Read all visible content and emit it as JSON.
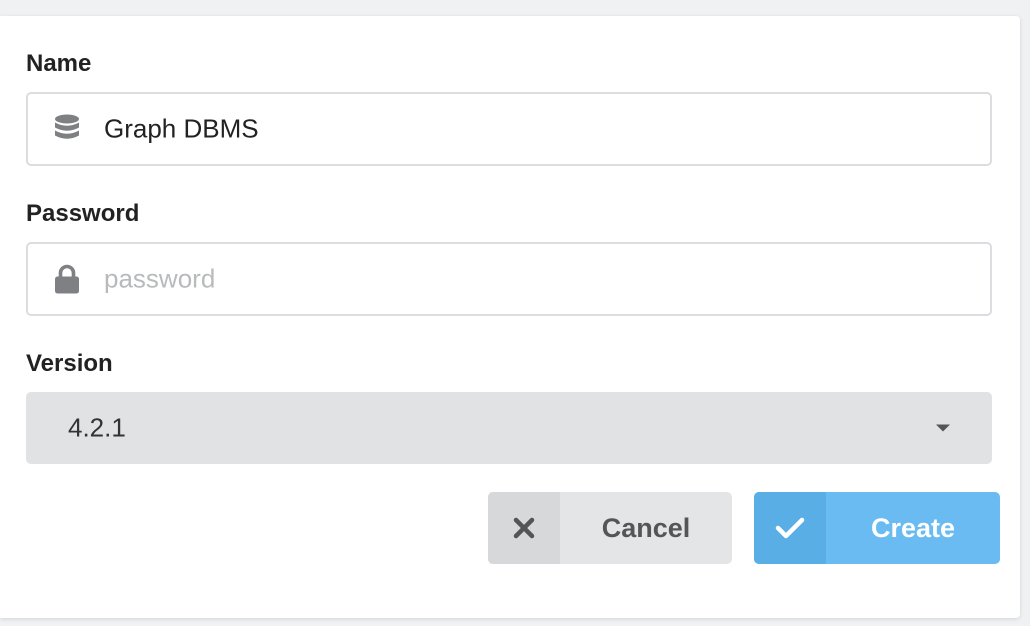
{
  "form": {
    "name": {
      "label": "Name",
      "value": "Graph DBMS",
      "icon": "database-icon"
    },
    "password": {
      "label": "Password",
      "value": "",
      "placeholder": "password",
      "icon": "lock-icon"
    },
    "version": {
      "label": "Version",
      "selected": "4.2.1",
      "icon": "caret-down-icon"
    }
  },
  "actions": {
    "cancel": {
      "label": "Cancel",
      "icon": "close-icon"
    },
    "create": {
      "label": "Create",
      "icon": "check-icon"
    }
  },
  "colors": {
    "primary": "#69bbf1",
    "primary_dark": "#5aaee6",
    "secondary": "#e4e5e7"
  }
}
